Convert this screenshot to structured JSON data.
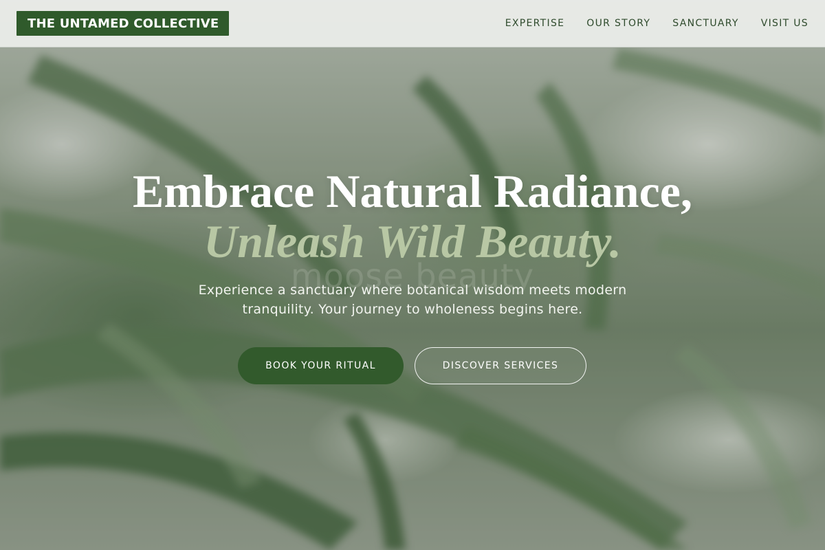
{
  "brand": {
    "logo_text": "THE UNTAMED COLLECTIVE",
    "accent_color": "#2f5a2b"
  },
  "nav": {
    "items": [
      {
        "label": "EXPERTISE"
      },
      {
        "label": "OUR STORY"
      },
      {
        "label": "SANCTUARY"
      },
      {
        "label": "VISIT US"
      }
    ]
  },
  "hero": {
    "headline_line1": "Embrace Natural Radiance,",
    "headline_line2": "Unleash Wild Beauty.",
    "watermark": "moose beauty",
    "subtext": "Experience a sanctuary where botanical wisdom meets modern tranquility. Your journey to wholeness begins here.",
    "primary_button": "BOOK YOUR RITUAL",
    "secondary_button": "DISCOVER SERVICES"
  }
}
